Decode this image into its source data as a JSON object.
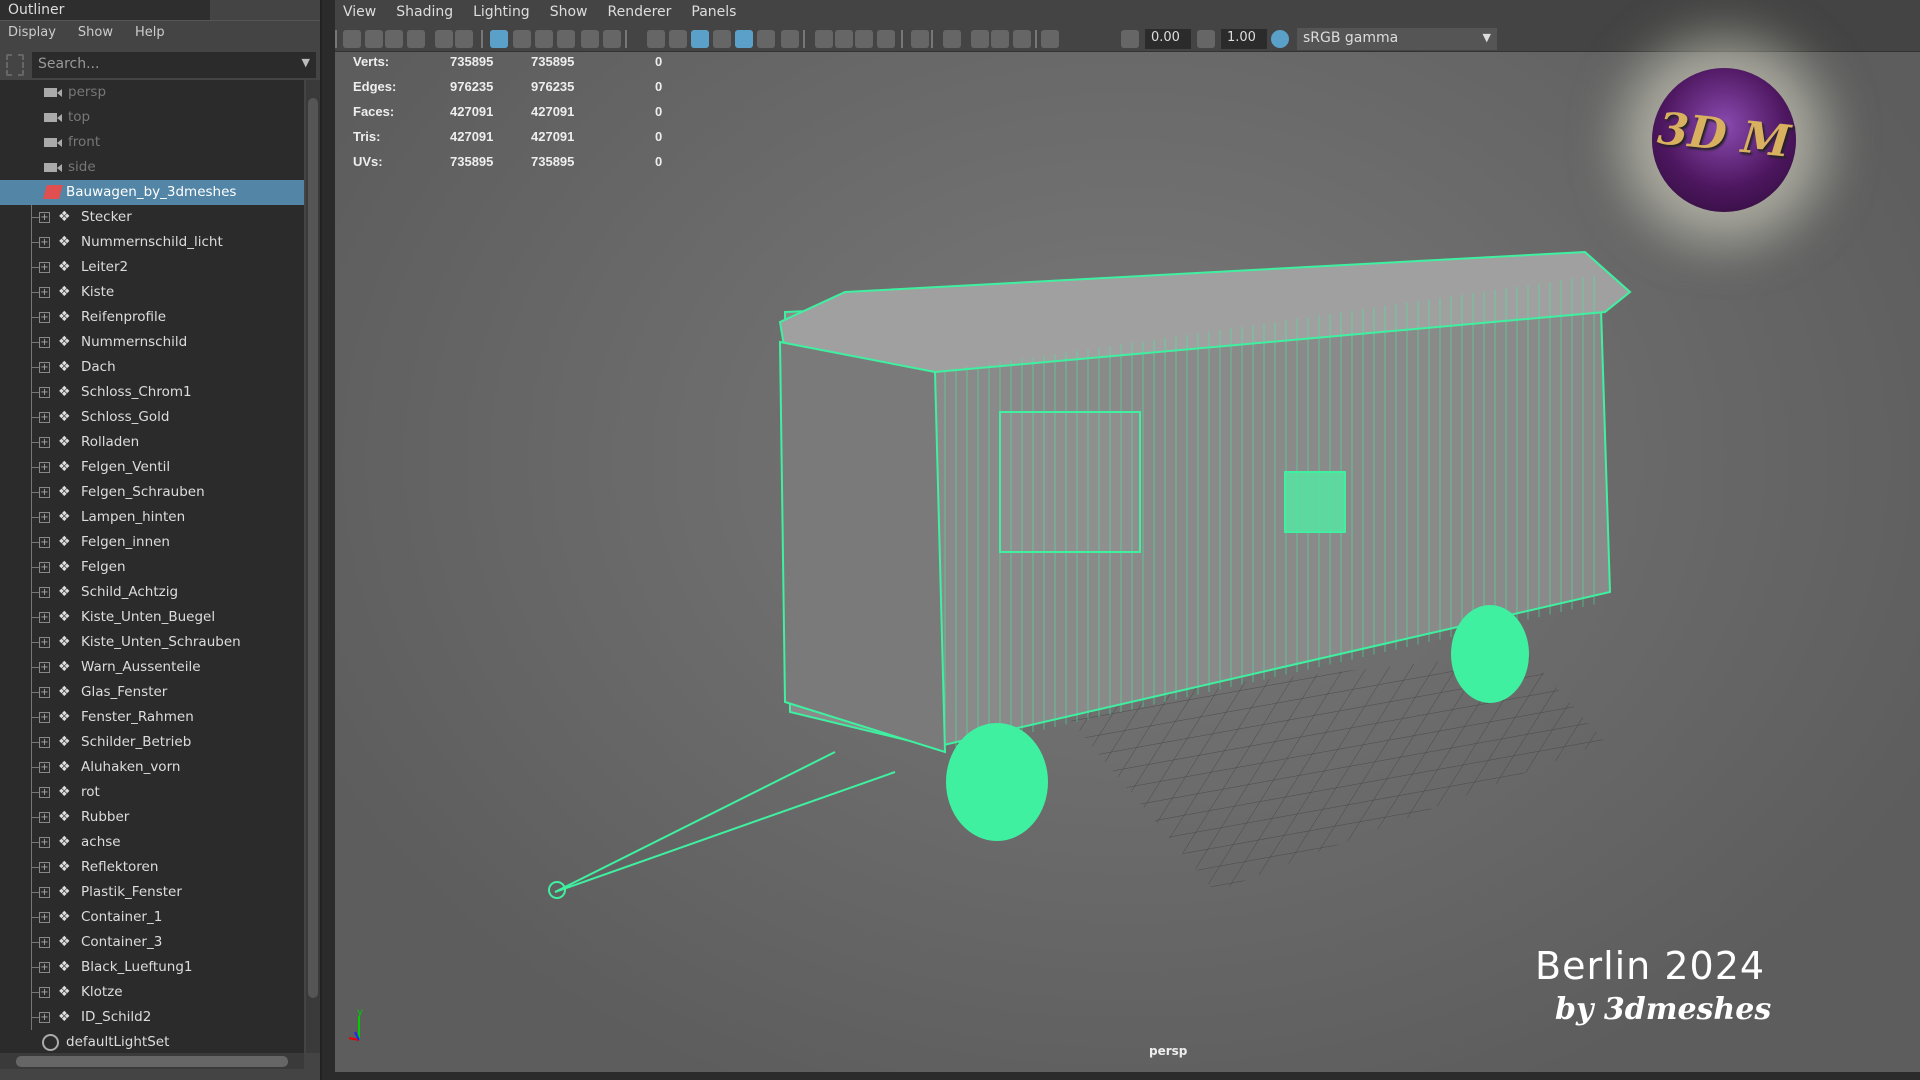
{
  "outliner": {
    "title": "Outliner",
    "menu": [
      "Display",
      "Show",
      "Help"
    ],
    "search_placeholder": "Search...",
    "cameras": [
      "persp",
      "top",
      "front",
      "side"
    ],
    "root": "Bauwagen_by_3dmeshes",
    "children": [
      "Stecker",
      "Nummernschild_licht",
      "Leiter2",
      "Kiste",
      "Reifenprofile",
      "Nummernschild",
      "Dach",
      "Schloss_Chrom1",
      "Schloss_Gold",
      "Rolladen",
      "Felgen_Ventil",
      "Felgen_Schrauben",
      "Lampen_hinten",
      "Felgen_innen",
      "Felgen",
      "Schild_Achtzig",
      "Kiste_Unten_Buegel",
      "Kiste_Unten_Schrauben",
      "Warn_Aussenteile",
      "Glas_Fenster",
      "Fenster_Rahmen",
      "Schilder_Betrieb",
      "Aluhaken_vorn",
      "rot",
      "Rubber",
      "achse",
      "Reflektoren",
      "Plastik_Fenster",
      "Container_1",
      "Container_3",
      "Black_Lueftung1",
      "Klotze",
      "ID_Schild2"
    ],
    "light_set": "defaultLightSet"
  },
  "viewport": {
    "menu": [
      "View",
      "Shading",
      "Lighting",
      "Show",
      "Renderer",
      "Panels"
    ],
    "exposure": "0.00",
    "gamma": "1.00",
    "color_space": "sRGB gamma",
    "stats": [
      [
        "Verts:",
        "735895",
        "735895",
        "0"
      ],
      [
        "Edges:",
        "976235",
        "976235",
        "0"
      ],
      [
        "Faces:",
        "427091",
        "427091",
        "0"
      ],
      [
        "Tris:",
        "427091",
        "427091",
        "0"
      ],
      [
        "UVs:",
        "735895",
        "735895",
        "0"
      ]
    ],
    "camera_label": "persp",
    "logo": "3D M",
    "watermark_1": "Berlin 2024",
    "watermark_2": "by 3dmeshes",
    "axis": [
      "x",
      "y",
      "z"
    ],
    "wire_color": "#3ff0a0"
  }
}
